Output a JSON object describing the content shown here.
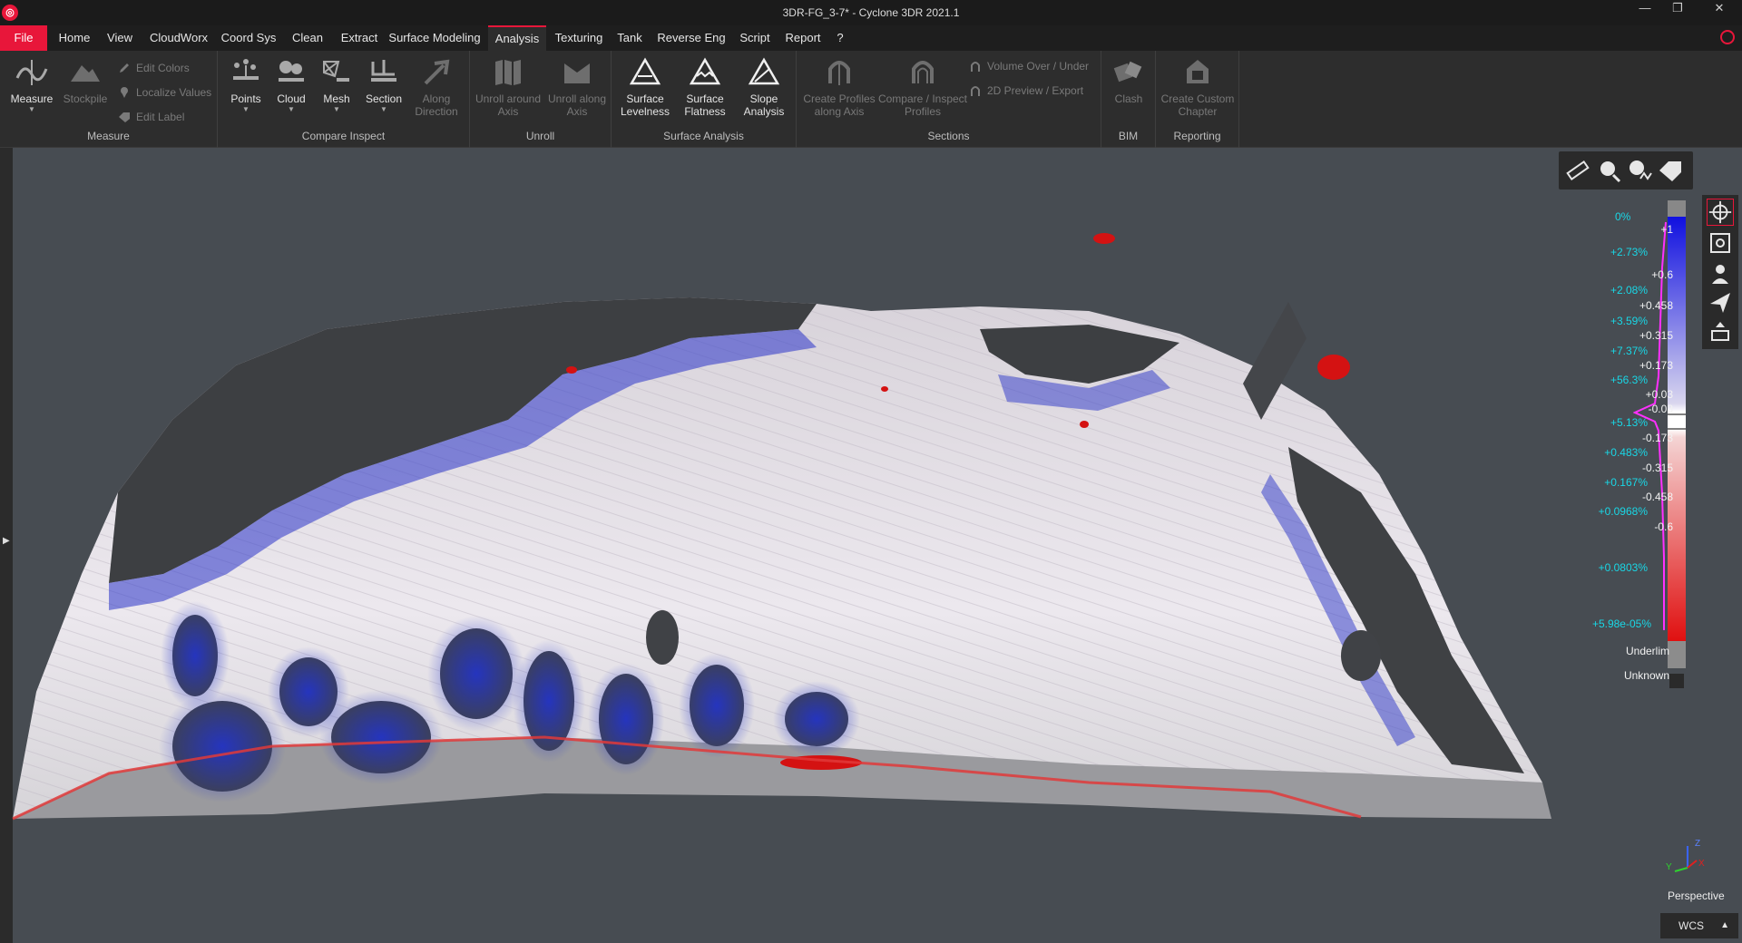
{
  "window": {
    "title": "3DR-FG_3-7* - Cyclone 3DR 2021.1",
    "controls": {
      "minimize": "—",
      "restore": "❐",
      "close": "✕"
    }
  },
  "menu": {
    "items": [
      "File",
      "Home",
      "View",
      "CloudWorx",
      "Coord Sys",
      "Clean",
      "Extract",
      "Surface Modeling",
      "Analysis",
      "Texturing",
      "Tank",
      "Reverse Eng",
      "Script",
      "Report",
      "?"
    ],
    "active": "Analysis"
  },
  "ribbon": {
    "measure_group": {
      "label": "Measure",
      "measure": "Measure",
      "stockpile": "Stockpile",
      "edit_colors": "Edit Colors",
      "localize_values": "Localize Values",
      "edit_label": "Edit Label"
    },
    "compare_group": {
      "label": "Compare Inspect",
      "points": "Points",
      "cloud": "Cloud",
      "mesh": "Mesh",
      "section": "Section",
      "along_direction_1": "Along",
      "along_direction_2": "Direction"
    },
    "unroll_group": {
      "label": "Unroll",
      "unroll_around_1": "Unroll around",
      "unroll_around_2": "Axis",
      "unroll_along_1": "Unroll along",
      "unroll_along_2": "Axis"
    },
    "surface_group": {
      "label": "Surface Analysis",
      "levelness_1": "Surface",
      "levelness_2": "Levelness",
      "flatness_1": "Surface",
      "flatness_2": "Flatness",
      "slope_1": "Slope",
      "slope_2": "Analysis"
    },
    "sections_group": {
      "label": "Sections",
      "create_profiles_1": "Create Profiles",
      "create_profiles_2": "along Axis",
      "compare_profiles_1": "Compare / Inspect",
      "compare_profiles_2": "Profiles",
      "volume_over_under": "Volume Over / Under",
      "preview_export": "2D Preview / Export"
    },
    "bim_group": {
      "label": "BIM",
      "clash": "Clash"
    },
    "reporting_group": {
      "label": "Reporting",
      "create_custom_1": "Create Custom",
      "create_custom_2": "Chapter"
    }
  },
  "legend": {
    "top_percent": "0%",
    "entries": [
      {
        "value": "+1",
        "percent": "+2.73%"
      },
      {
        "value": "+0.6",
        "percent": "+2.08%"
      },
      {
        "value": "+0.458",
        "percent": "+3.59%"
      },
      {
        "value": "+0.315",
        "percent": "+7.37%"
      },
      {
        "value": "+0.173",
        "percent": "+56.3%"
      },
      {
        "value": "+0.03",
        "percent": ""
      },
      {
        "value": "-0.03",
        "percent": "+5.13%"
      },
      {
        "value": "-0.173",
        "percent": "+0.483%"
      },
      {
        "value": "-0.315",
        "percent": "+0.167%"
      },
      {
        "value": "-0.458",
        "percent": "+0.0968%"
      },
      {
        "value": "-0.6",
        "percent": "+0.0803%"
      },
      {
        "value": "",
        "percent": "+5.98e-05%"
      }
    ],
    "underlimit": "Underlim",
    "unknown": "Unknown"
  },
  "view": {
    "projection": "Perspective",
    "coord_system": "WCS",
    "axis_z": "Z",
    "axis_y": "Y",
    "axis_x": "X"
  },
  "colors": {
    "accent": "#e8163a",
    "viewport_bg": "#474c52",
    "legend_cyan": "#19d7e6",
    "deviation_blue": "#1428d2",
    "deviation_red": "#e01414"
  }
}
